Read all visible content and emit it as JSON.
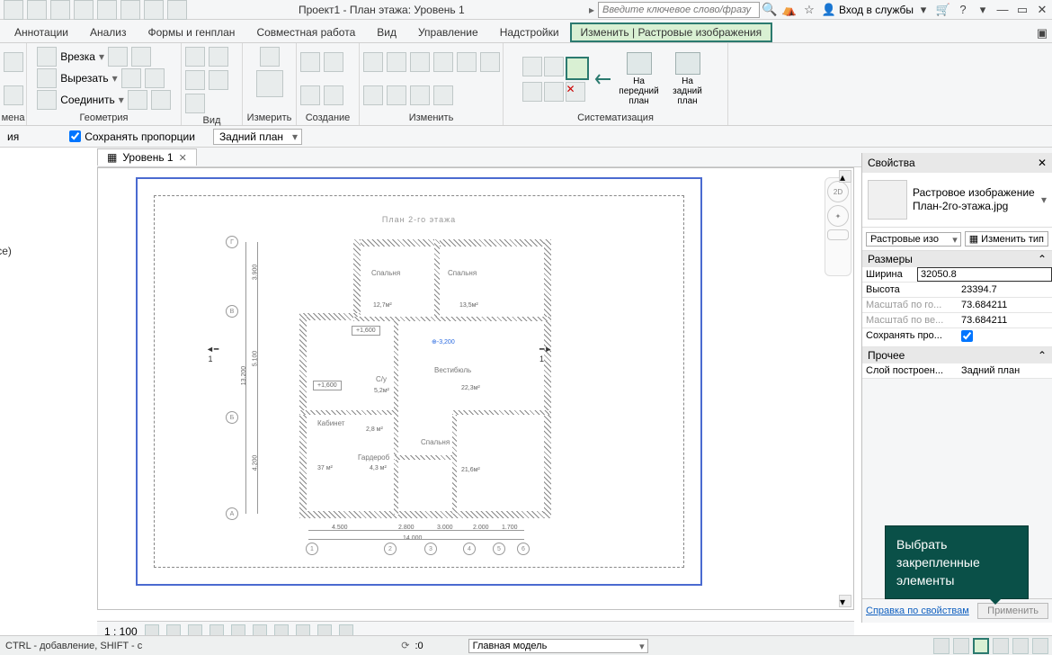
{
  "title": "Проект1 - План этажа: Уровень 1",
  "search_placeholder": "Введите ключевое слово/фразу",
  "signin": "Вход в службы",
  "ribbon": {
    "tabs": [
      "Аннотации",
      "Анализ",
      "Формы и генплан",
      "Совместная работа",
      "Вид",
      "Управление",
      "Надстройки",
      "Изменить | Растровые изображения"
    ],
    "active_index": 7,
    "panels": {
      "p0": {
        "label": "мена"
      },
      "p1": {
        "label": "Геометрия",
        "items": {
          "cut": "Врезка",
          "cutout": "Вырезать",
          "join": "Соединить"
        }
      },
      "p2": {
        "label": "Вид"
      },
      "p3": {
        "label": "Измерить"
      },
      "p4": {
        "label": "Создание"
      },
      "p5": {
        "label": "Изменить"
      },
      "p6": {
        "label": "Систематизация",
        "front": "На передний план",
        "back": "На задний план"
      }
    }
  },
  "opts": {
    "keep": "Сохранять пропорции",
    "order": "Задний план"
  },
  "doc_tab": "Уровень 1",
  "left_frags": {
    "a": "ия",
    "b": "все)"
  },
  "scale": "1 : 100",
  "drawing_title": "План 2-го этажа",
  "drawing": {
    "grid_letters": [
      "А",
      "Б",
      "В",
      "Г"
    ],
    "grid_nums": [
      "1",
      "2",
      "3",
      "4",
      "5",
      "6"
    ],
    "rooms": {
      "sp1": "Спальня",
      "sp2": "Спальня",
      "sp3": "Спальня",
      "kab": "Кабинет",
      "gard": "Гардероб",
      "vest": "Вестибюль",
      "su": "С/у"
    },
    "areas": {
      "a1": "12,7м²",
      "a2": "13,5м²",
      "a3": "5,2м²",
      "a4": "22,3м²",
      "a5": "37 м²",
      "a6": "4,3 м²",
      "a7": "21,6м²",
      "a8": "2,8 м²"
    },
    "notes": {
      "n1": "+1,600",
      "n2": "+1,600",
      "n3": "⊕-3,200"
    },
    "dims": {
      "d1": "3.900",
      "d2": "5.100",
      "d3": "13.200",
      "d4": "4.200",
      "d5": "4.500",
      "d6": "2.800",
      "d7": "3.000",
      "d8": "2.000",
      "d9": "1.700",
      "d10": "14.000"
    }
  },
  "props": {
    "title": "Свойства",
    "type_name": "Растровое изображение",
    "file": "План-2го-этажа.jpg",
    "type_sel": "Растровые изо",
    "edit_type": "Изменить тип",
    "groups": {
      "size": "Размеры",
      "other": "Прочее"
    },
    "fields": {
      "width": {
        "k": "Ширина",
        "v": "32050.8"
      },
      "height": {
        "k": "Высота",
        "v": "23394.7"
      },
      "scx": {
        "k": "Масштаб по го...",
        "v": "73.684211"
      },
      "scy": {
        "k": "Масштаб по ве...",
        "v": "73.684211"
      },
      "keep": {
        "k": "Сохранять про..."
      },
      "layer": {
        "k": "Слой построен...",
        "v": "Задний план"
      }
    },
    "help": "Справка по свойствам",
    "apply": "Применить"
  },
  "tooltip": "Выбрать закрепленные элементы",
  "status": {
    "msg": "CTRL - добавление, SHIFT - с",
    "model": "Главная модель"
  }
}
